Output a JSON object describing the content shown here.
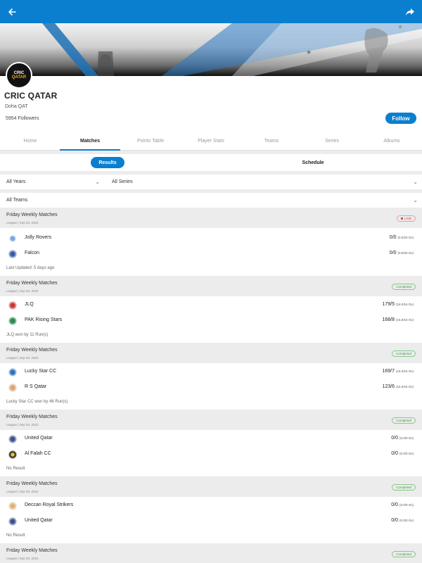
{
  "colors": {
    "primary": "#0a7fd0",
    "completed": "#3e9c43",
    "live": "#d23b3b"
  },
  "icons": {
    "back": "arrow-left-icon",
    "share": "share-arrow-icon"
  },
  "team": {
    "logo_line1": "CRIC",
    "logo_line2": "QATAR",
    "name": "CRIC QATAR",
    "location": "Doha QAT",
    "followers": "5954 Followers",
    "follow_label": "Follow"
  },
  "tabs": [
    {
      "label": "Home",
      "active": false
    },
    {
      "label": "Matches",
      "active": true
    },
    {
      "label": "Points Table",
      "active": false
    },
    {
      "label": "Player Stats",
      "active": false
    },
    {
      "label": "Teams",
      "active": false
    },
    {
      "label": "Series",
      "active": false
    },
    {
      "label": "Albums",
      "active": false
    }
  ],
  "subtabs": {
    "results": "Results",
    "schedule": "Schedule"
  },
  "filters": {
    "years": "All Years",
    "series": "All Series",
    "teams": "All Teams"
  },
  "matches": [
    {
      "title": "Friday Weekly Matches",
      "subtitle": "League | Sep 03, 2022",
      "status": "LIVE",
      "teams": [
        {
          "name": "Jolly Rovers",
          "score": "0/0",
          "overs": "(0.0/20 Ov)"
        },
        {
          "name": "Falcon",
          "score": "0/0",
          "overs": "(0.0/20 Ov)"
        }
      ],
      "result": "Last Updated: 5 days ago"
    },
    {
      "title": "Friday Weekly Matches",
      "subtitle": "League | Sep 03, 2022",
      "status": "Completed",
      "teams": [
        {
          "name": "JLQ",
          "score": "179/5",
          "overs": "(16.0/16 Ov)"
        },
        {
          "name": "PAK Rising Stars",
          "score": "168/8",
          "overs": "(16.0/16 Ov)"
        }
      ],
      "result": "JLQ won by 11 Run(s)"
    },
    {
      "title": "Friday Weekly Matches",
      "subtitle": "League | Sep 03, 2022",
      "status": "Completed",
      "teams": [
        {
          "name": "Lucky Star CC",
          "score": "169/7",
          "overs": "(16.0/16 Ov)"
        },
        {
          "name": "R S Qatar",
          "score": "123/6",
          "overs": "(16.0/16 Ov)"
        }
      ],
      "result": "Lucky Star CC won by 46 Run(s)"
    },
    {
      "title": "Friday Weekly Matches",
      "subtitle": "League | Sep 03, 2022",
      "status": "Completed",
      "teams": [
        {
          "name": "United Qatar",
          "score": "0/0",
          "overs": "(0.0/0 Ov)"
        },
        {
          "name": "Al Falah CC",
          "score": "0/0",
          "overs": "(0.0/0 Ov)"
        }
      ],
      "result": "No Result"
    },
    {
      "title": "Friday Weekly Matches",
      "subtitle": "League | Sep 03, 2022",
      "status": "Completed",
      "teams": [
        {
          "name": "Deccan Royal Strikers",
          "score": "0/0",
          "overs": "(0.0/0 Ov)"
        },
        {
          "name": "United Qatar",
          "score": "0/0",
          "overs": "(0.0/0 Ov)"
        }
      ],
      "result": "No Result"
    },
    {
      "title": "Friday Weekly Matches",
      "subtitle": "League | Sep 03, 2022",
      "status": "Completed",
      "teams": [],
      "result": ""
    }
  ]
}
